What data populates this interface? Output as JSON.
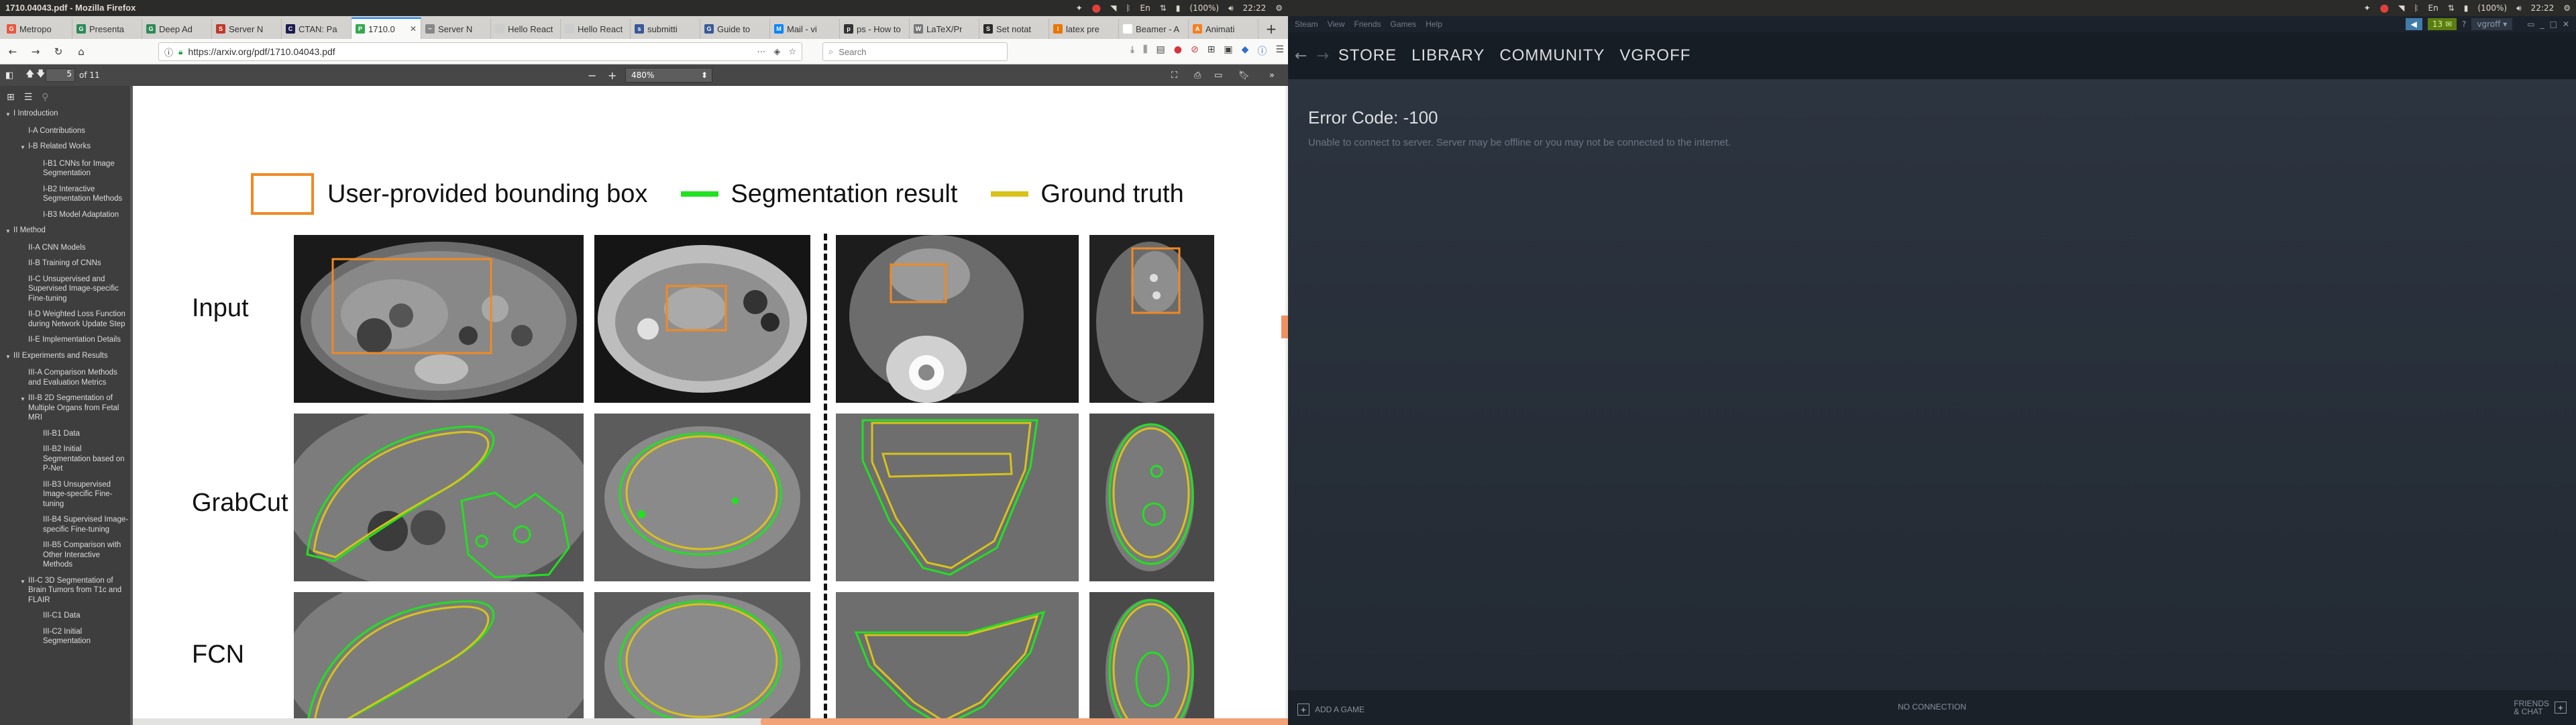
{
  "left_panel": {
    "window_title": "1710.04043.pdf - Mozilla Firefox",
    "tray": {
      "battery": "(100%)",
      "time": "22:22"
    }
  },
  "right_panel": {
    "tray": {
      "battery": "(100%)",
      "time": "22:22"
    }
  },
  "firefox": {
    "tabs": [
      {
        "label": "Metropo",
        "color": "#e9573f",
        "glyph": "G"
      },
      {
        "label": "Presenta",
        "color": "#2e8b57",
        "glyph": "G"
      },
      {
        "label": "Deep Ad",
        "color": "#2e8b57",
        "glyph": "G"
      },
      {
        "label": "Server N",
        "color": "#c0392b",
        "glyph": "S"
      },
      {
        "label": "CTAN: Pa",
        "color": "#1b1b4d",
        "glyph": "C"
      },
      {
        "label": "1710.0",
        "color": "#36a852",
        "glyph": "P",
        "active": true
      },
      {
        "label": "Server N",
        "color": "#888888",
        "glyph": "~"
      },
      {
        "label": "Hello React",
        "color": "#cccccc",
        "glyph": ""
      },
      {
        "label": "Hello React",
        "color": "#cccccc",
        "glyph": ""
      },
      {
        "label": "submitti",
        "color": "#3b5998",
        "glyph": "s"
      },
      {
        "label": "Guide to",
        "color": "#3b5998",
        "glyph": "G"
      },
      {
        "label": "Mail - vi",
        "color": "#0a84ff",
        "glyph": "M"
      },
      {
        "label": "ps - How to",
        "color": "#333333",
        "glyph": "p"
      },
      {
        "label": "LaTeX/Pr",
        "color": "#777777",
        "glyph": "W"
      },
      {
        "label": "Set notat",
        "color": "#2b2b2b",
        "glyph": "S"
      },
      {
        "label": "latex pre",
        "color": "#ea7600",
        "glyph": "l"
      },
      {
        "label": "Beamer - A",
        "color": "#ffffff",
        "glyph": ""
      },
      {
        "label": "Animati",
        "color": "#f48024",
        "glyph": "A"
      }
    ],
    "url": "https://arxiv.org/pdf/1710.04043.pdf",
    "search_placeholder": "Search"
  },
  "pdfjs": {
    "page_number": "5",
    "page_total": "of 11",
    "zoom": "480%",
    "outline": [
      {
        "level": 0,
        "expanded": true,
        "label": "I Introduction"
      },
      {
        "level": 1,
        "label": "I-A Contributions"
      },
      {
        "level": 1,
        "expanded": true,
        "label": "I-B Related Works"
      },
      {
        "level": 2,
        "label": "I-B1 CNNs for Image Segmentation"
      },
      {
        "level": 2,
        "label": "I-B2 Interactive Segmentation Methods"
      },
      {
        "level": 2,
        "label": "I-B3 Model Adaptation"
      },
      {
        "level": 0,
        "expanded": true,
        "label": "II Method"
      },
      {
        "level": 1,
        "label": "II-A CNN Models"
      },
      {
        "level": 1,
        "label": "II-B Training of CNNs"
      },
      {
        "level": 1,
        "label": "II-C Unsupervised and Supervised Image-specific Fine-tuning"
      },
      {
        "level": 1,
        "label": "II-D Weighted Loss Function during Network Update Step"
      },
      {
        "level": 1,
        "label": "II-E Implementation Details"
      },
      {
        "level": 0,
        "expanded": true,
        "label": "III Experiments and Results"
      },
      {
        "level": 1,
        "label": "III-A Comparison Methods and Evaluation Metrics"
      },
      {
        "level": 1,
        "expanded": true,
        "label": "III-B 2D Segmentation of Multiple Organs from Fetal MRI"
      },
      {
        "level": 2,
        "label": "III-B1 Data"
      },
      {
        "level": 2,
        "label": "III-B2 Initial Segmentation based on P-Net"
      },
      {
        "level": 2,
        "label": "III-B3 Unsupervised Image-specific Fine-tuning"
      },
      {
        "level": 2,
        "label": "III-B4 Supervised Image-specific Fine-tuning"
      },
      {
        "level": 2,
        "label": "III-B5 Comparison with Other Interactive Methods"
      },
      {
        "level": 1,
        "expanded": true,
        "label": "III-C 3D Segmentation of Brain Tumors from T1c and FLAIR"
      },
      {
        "level": 2,
        "label": "III-C1 Data"
      },
      {
        "level": 2,
        "label": "III-C2 Initial Segmentation"
      }
    ]
  },
  "figure": {
    "legend": {
      "bbox_label": "User-provided bounding box",
      "seg_label": "Segmentation result",
      "gt_label": "Ground truth",
      "bbox_color": "#f08a24",
      "seg_color": "#22e022",
      "gt_color": "#d8c21a"
    },
    "rows": [
      "Input",
      "GrabCut",
      "FCN"
    ]
  },
  "steam": {
    "menu": [
      "Steam",
      "View",
      "Friends",
      "Games",
      "Help"
    ],
    "notification_count": "13",
    "username": "vgroff",
    "nav": [
      "STORE",
      "LIBRARY",
      "COMMUNITY",
      "VGROFF"
    ],
    "error_code": "Error Code: -100",
    "error_message": "Unable to connect to server. Server may be offline or you may not be connected to the internet.",
    "add_game": "ADD A GAME",
    "connection_status": "NO CONNECTION",
    "friends_line1": "FRIENDS",
    "friends_line2": "& CHAT"
  }
}
